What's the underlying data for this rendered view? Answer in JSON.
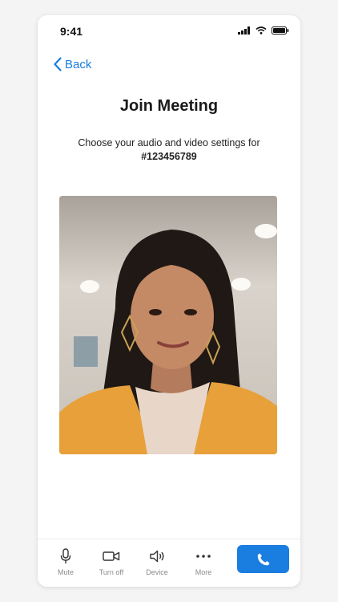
{
  "status": {
    "time": "9:41"
  },
  "nav": {
    "back_label": "Back"
  },
  "header": {
    "title": "Join Meeting"
  },
  "subtitle": {
    "line": "Choose your audio and video settings for",
    "meeting_id": "#123456789"
  },
  "preview": {
    "description": "video-preview"
  },
  "toolbar": {
    "items": [
      {
        "label": "Mute",
        "icon": "microphone-icon"
      },
      {
        "label": "Turn off",
        "icon": "video-camera-icon"
      },
      {
        "label": "Device",
        "icon": "speaker-icon"
      },
      {
        "label": "More",
        "icon": "more-icon"
      }
    ],
    "join_icon": "phone-icon"
  },
  "colors": {
    "accent": "#1a7de0",
    "label_gray": "#8a8a8a"
  }
}
